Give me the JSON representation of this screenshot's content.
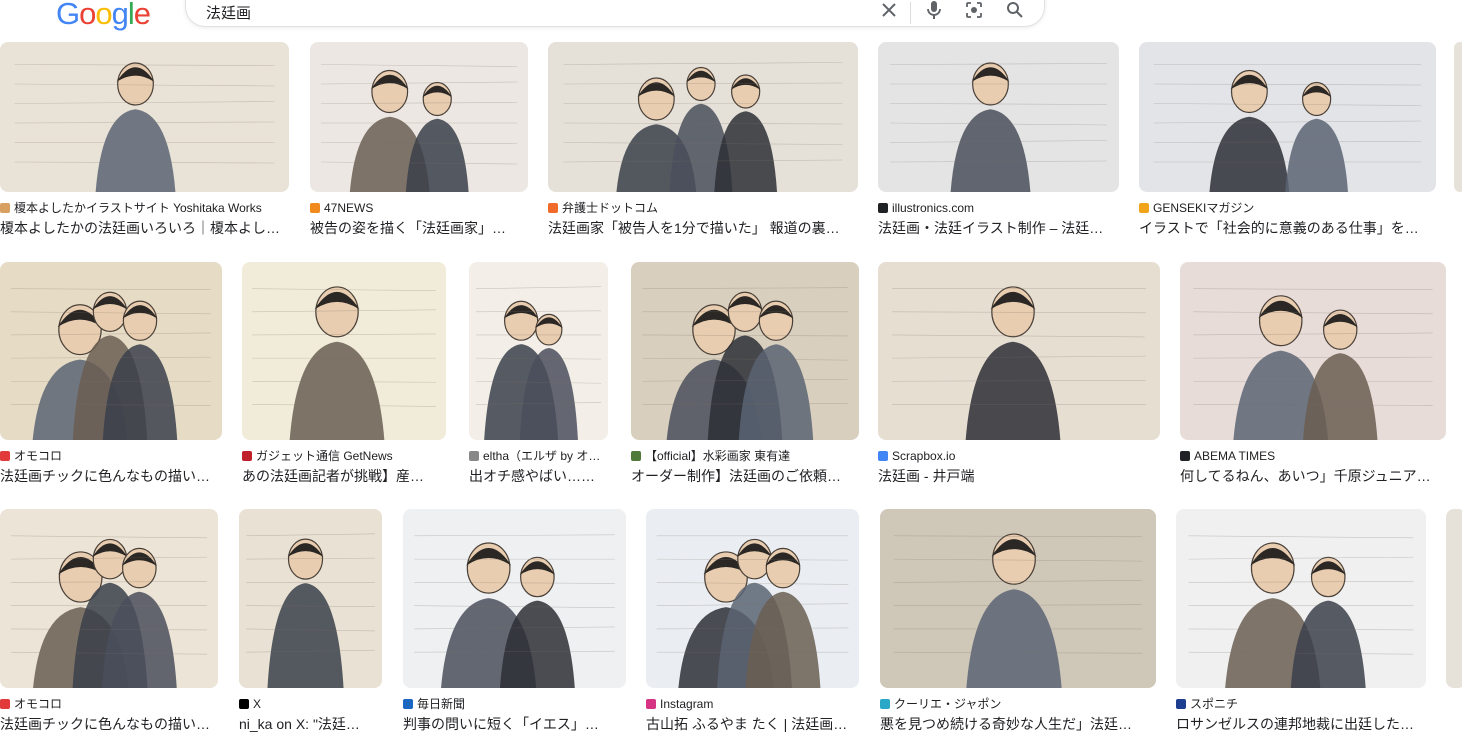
{
  "logo": {
    "letters": [
      "G",
      "o",
      "o",
      "g",
      "l",
      "e"
    ],
    "colors": [
      "#4285F4",
      "#EA4335",
      "#FBBC05",
      "#4285F4",
      "#34A853",
      "#EA4335"
    ]
  },
  "search": {
    "query": "法廷画"
  },
  "icons": {
    "clear": "close-icon",
    "voice": "mic-icon",
    "lens": "camera-lens-icon",
    "search": "search-icon"
  },
  "results": [
    {
      "source": "榎本よしたかイラストサイト Yoshitaka Works",
      "title": "榎本よしたかの法廷画いろいろ｜榎本よし…",
      "fav": "#d8a060",
      "tone": "#e9e2d6"
    },
    {
      "source": "47NEWS",
      "title": "被告の姿を描く「法廷画家」…",
      "fav": "#f08a1c",
      "tone": "#ece7e2"
    },
    {
      "source": "弁護士ドットコム",
      "title": "法廷画家「被告人を1分で描いた」 報道の裏…",
      "fav": "#f06a2a",
      "tone": "#e5e0d8"
    },
    {
      "source": "illustronics.com",
      "title": "法廷画・法廷イラスト制作 – 法廷…",
      "fav": "#202124",
      "tone": "#e4e4e4"
    },
    {
      "source": "GENSEKIマガジン",
      "title": "イラストで「社会的に意義のある仕事」を…",
      "fav": "#f2a51a",
      "tone": "#e2e4e8"
    },
    {
      "source": "オモコロ",
      "title": "法廷画チックに色んなもの描い…",
      "fav": "#e23a3a",
      "tone": "#e6dcc6"
    },
    {
      "source": "ガジェット通信 GetNews",
      "title": "あの法廷画記者が挑戦】産…",
      "fav": "#c0202a",
      "tone": "#f1ecd9"
    },
    {
      "source": "eltha（エルザ by オ…",
      "title": "出オチ感やばい……",
      "fav": "#888888",
      "tone": "#f3efe8"
    },
    {
      "source": "【official】水彩画家 東有達",
      "title": "オーダー制作】法廷画のご依頼…",
      "fav": "#4f7a3a",
      "tone": "#d8cfbe"
    },
    {
      "source": "Scrapbox.io",
      "title": "法廷画 - 井戸端",
      "fav": "#4285f4",
      "tone": "#e7ded2"
    },
    {
      "source": "ABEMA TIMES",
      "title": "何してるねん、あいつ」千原ジュニア…",
      "fav": "#202124",
      "tone": "#e8dcd8"
    },
    {
      "source": "オモコロ",
      "title": "法廷画チックに色んなもの描い…",
      "fav": "#e23a3a",
      "tone": "#ece4d6"
    },
    {
      "source": "X",
      "title": "ni_ka on X: \"法廷…",
      "fav": "#000000",
      "tone": "#e9e1d3"
    },
    {
      "source": "毎日新聞",
      "title": "判事の問いに短く「イエス」…",
      "fav": "#1a66c0",
      "tone": "#eef0f2"
    },
    {
      "source": "Instagram",
      "title": "古山拓 ふるやま たく | 法廷画…",
      "fav": "#d63384",
      "tone": "#eaeef2"
    },
    {
      "source": "クーリエ・ジャポン",
      "title": "悪を見つめ続ける奇妙な人生だ」法廷…",
      "fav": "#2aa8c8",
      "tone": "#cfc7b8"
    },
    {
      "source": "スポニチ",
      "title": "ロサンゼルスの連邦地裁に出廷した…",
      "fav": "#1d3d8f",
      "tone": "#f0f0f0"
    }
  ]
}
